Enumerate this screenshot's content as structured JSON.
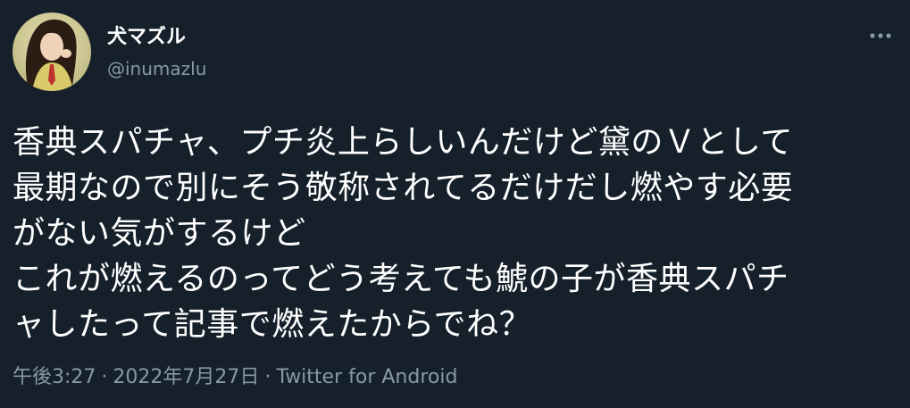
{
  "author": {
    "display_name": "犬マズル",
    "handle": "@inumazlu"
  },
  "tweet": {
    "lines": [
      "香典スパチャ、プチ炎上らしいんだけど黛のＶとして",
      "最期なので別にそう敬称されてるだけだし燃やす必要",
      "がない気がするけど",
      "これが燃えるのってどう考えても鯱の子が香典スパチ",
      "ャしたって記事で燃えたからでね？"
    ]
  },
  "meta": {
    "time": "午後3:27",
    "separator": "·",
    "date": "2022年7月27日",
    "source": "Twitter for Android"
  },
  "icons": {
    "more": "more-horizontal-icon",
    "avatar": "avatar-image"
  },
  "colors": {
    "background": "#15202b",
    "text": "#ffffff",
    "secondary_text": "#8899a6"
  }
}
